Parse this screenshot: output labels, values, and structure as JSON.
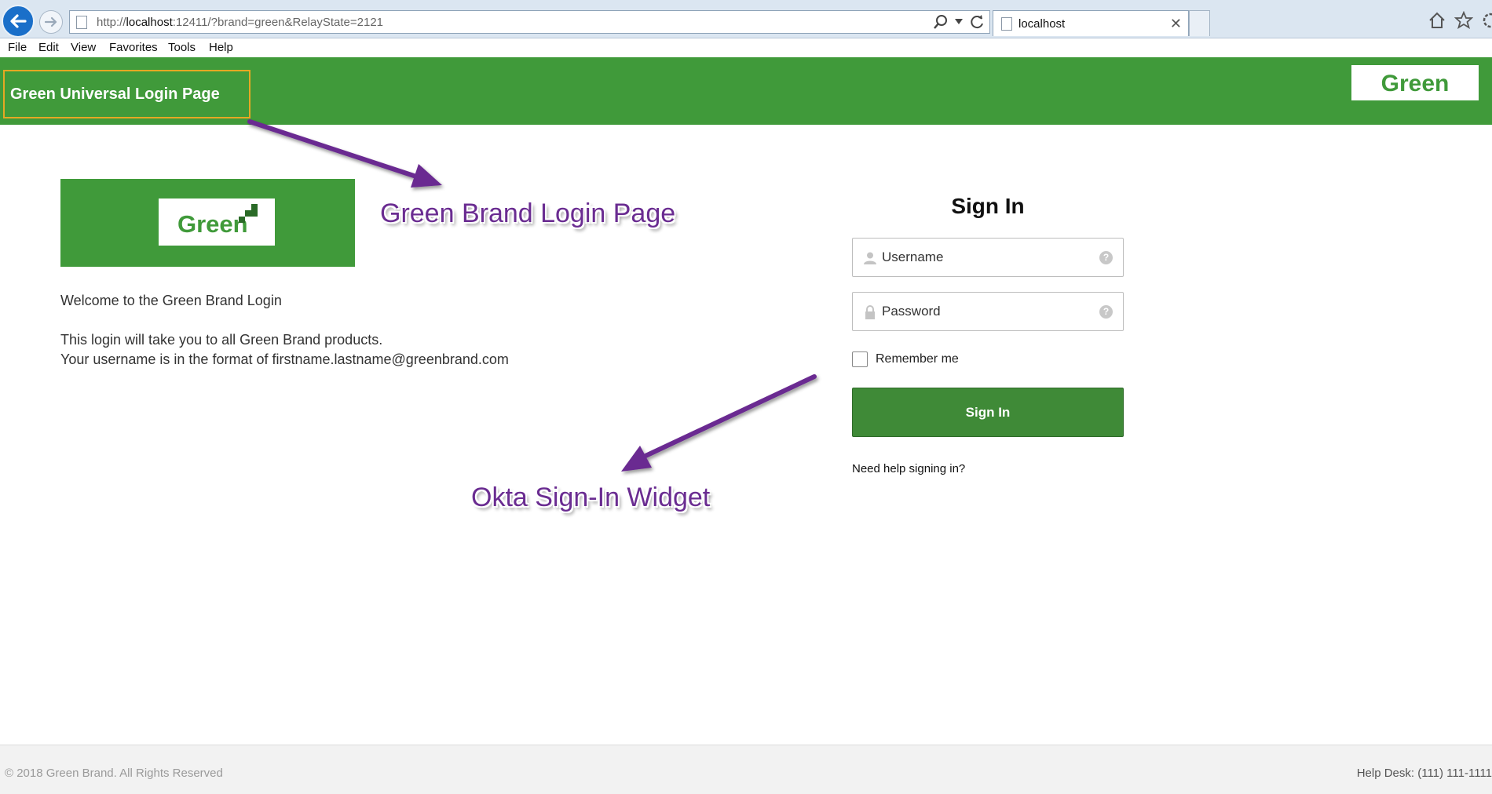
{
  "browser": {
    "url_prefix": "http://",
    "url_host": "localhost",
    "url_rest": ":12411/?brand=green&RelayState=2121",
    "tab_title": "localhost",
    "tab_close": "✕"
  },
  "menu": {
    "file": "File",
    "edit": "Edit",
    "view": "View",
    "favorites": "Favorites",
    "tools": "Tools",
    "help": "Help"
  },
  "header": {
    "title": "Green Universal Login Page",
    "logo": "Green"
  },
  "brand": {
    "logo": "Green",
    "welcome": "Welcome to the Green Brand Login",
    "info_line1": "This login will take you to all Green Brand products.",
    "info_line2": "Your username is in the format of firstname.lastname@greenbrand.com"
  },
  "signin": {
    "title": "Sign In",
    "username_placeholder": "Username",
    "password_placeholder": "Password",
    "help_glyph": "?",
    "remember_label": "Remember me",
    "button_label": "Sign In",
    "help_link": "Need help signing in?"
  },
  "annotations": {
    "brand_page": "Green Brand Login Page",
    "okta_widget": "Okta Sign-In Widget"
  },
  "footer": {
    "copyright": "© 2018 Green Brand. All Rights Reserved",
    "helpdesk": "Help Desk: (111) 111-1111"
  },
  "colors": {
    "brand_green": "#409a3a",
    "button_green": "#3f8a37",
    "annotation_purple": "#6a2c91",
    "highlight_orange": "#e5a823"
  },
  "icons": {
    "back": "back-arrow-icon",
    "forward": "forward-arrow-icon",
    "search": "search-icon",
    "refresh": "refresh-icon",
    "home": "home-icon",
    "favorites": "star-icon",
    "settings": "gear-icon",
    "user": "user-icon",
    "lock": "lock-icon"
  }
}
